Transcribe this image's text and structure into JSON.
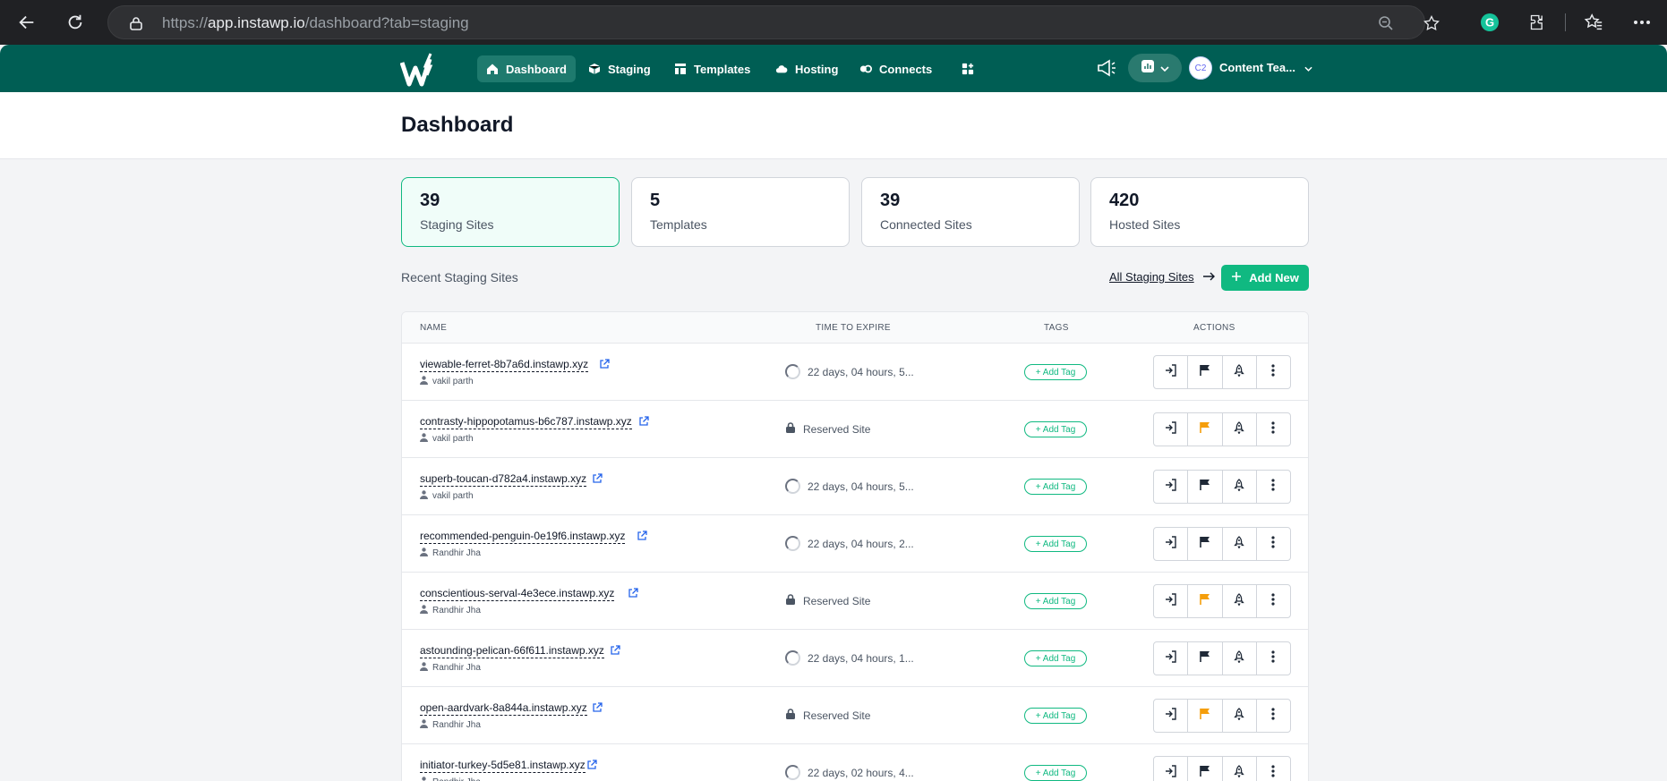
{
  "browser": {
    "url_prefix": "https://",
    "url_host": "app.instawp.io",
    "url_path": "/dashboard?tab=staging"
  },
  "nav": {
    "items": [
      {
        "label": "Dashboard",
        "icon": "home-icon"
      },
      {
        "label": "Staging",
        "icon": "cube-icon"
      },
      {
        "label": "Templates",
        "icon": "layout-icon"
      },
      {
        "label": "Hosting",
        "icon": "cloud-icon"
      },
      {
        "label": "Connects",
        "icon": "link-icon"
      }
    ],
    "avatar_initials": "C2",
    "user_name": "Content Tea..."
  },
  "page": {
    "title": "Dashboard"
  },
  "stats": [
    {
      "value": "39",
      "label": "Staging Sites"
    },
    {
      "value": "5",
      "label": "Templates"
    },
    {
      "value": "39",
      "label": "Connected Sites"
    },
    {
      "value": "420",
      "label": "Hosted Sites"
    }
  ],
  "recent": {
    "title": "Recent Staging Sites",
    "all_link": "All Staging Sites",
    "add_new": "Add New"
  },
  "table": {
    "headers": {
      "name": "NAME",
      "expire": "TIME TO EXPIRE",
      "tags": "TAGS",
      "actions": "ACTIONS"
    },
    "tag_label": "+ Add Tag",
    "rows": [
      {
        "site": "viewable-ferret-8b7a6d.instawp.xyz",
        "owner": "vakil parth",
        "expire": "22 days, 04 hours, 5...",
        "reserved": false
      },
      {
        "site": "contrasty-hippopotamus-b6c787.instawp.xyz",
        "owner": "vakil parth",
        "expire": "Reserved Site",
        "reserved": true
      },
      {
        "site": "superb-toucan-d782a4.instawp.xyz",
        "owner": "vakil parth",
        "expire": "22 days, 04 hours, 5...",
        "reserved": false
      },
      {
        "site": "recommended-penguin-0e19f6.instawp.xyz",
        "owner": "Randhir Jha",
        "expire": "22 days, 04 hours, 2...",
        "reserved": false
      },
      {
        "site": "conscientious-serval-4e3ece.instawp.xyz",
        "owner": "Randhir Jha",
        "expire": "Reserved Site",
        "reserved": true
      },
      {
        "site": "astounding-pelican-66f611.instawp.xyz",
        "owner": "Randhir Jha",
        "expire": "22 days, 04 hours, 1...",
        "reserved": false
      },
      {
        "site": "open-aardvark-8a844a.instawp.xyz",
        "owner": "Randhir Jha",
        "expire": "Reserved Site",
        "reserved": true
      },
      {
        "site": "initiator-turkey-5d5e81.instawp.xyz",
        "owner": "Randhir Jha",
        "expire": "22 days, 02 hours, 4...",
        "reserved": false
      }
    ]
  },
  "colors": {
    "brand": "#005e54",
    "accent": "#10b981",
    "flag_reserved": "#f59e0b"
  }
}
